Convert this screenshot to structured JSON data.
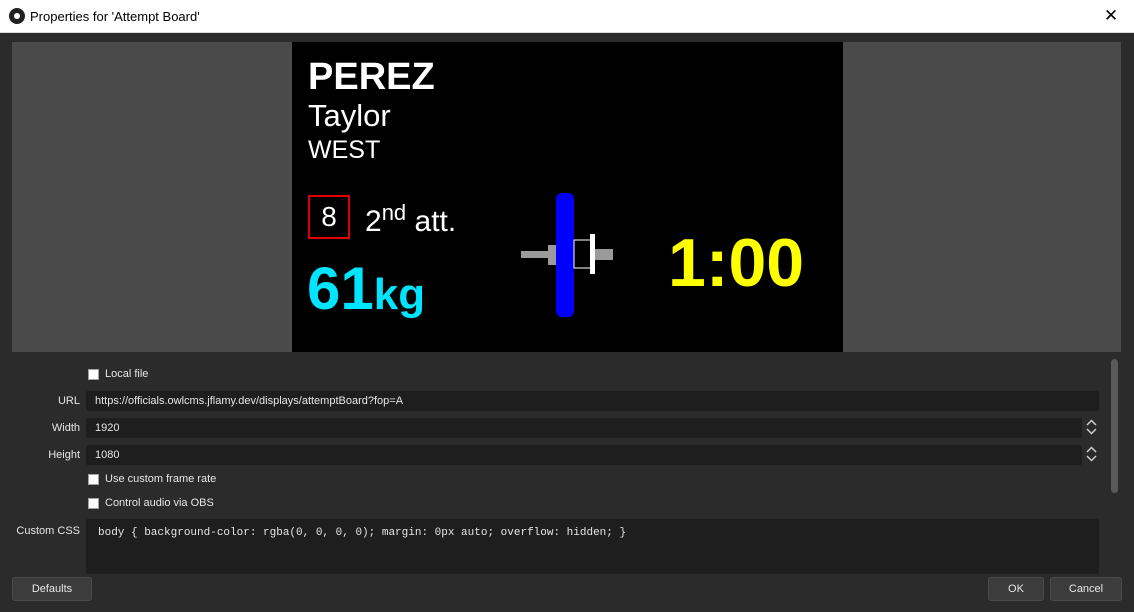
{
  "window": {
    "title": "Properties for 'Attempt Board'",
    "close_glyph": "✕"
  },
  "board": {
    "last_name": "PEREZ",
    "first_name": "Taylor",
    "team": "WEST",
    "start_number": "8",
    "attempt_number": "2",
    "attempt_suffix": "nd",
    "attempt_label": "att.",
    "weight": "61",
    "weight_unit": "kg",
    "clock": "1:00",
    "colors": {
      "weight": "#00e5ff",
      "clock": "#ffff00",
      "start_box": "#e00000",
      "plate": "#0000ff"
    }
  },
  "form": {
    "local_file_label": "Local file",
    "local_file_checked": false,
    "url_label": "URL",
    "url_value": "https://officials.owlcms.jflamy.dev/displays/attemptBoard?fop=A",
    "width_label": "Width",
    "width_value": "1920",
    "height_label": "Height",
    "height_value": "1080",
    "custom_frame_rate_label": "Use custom frame rate",
    "custom_frame_rate_checked": false,
    "control_audio_label": "Control audio via OBS",
    "control_audio_checked": false,
    "custom_css_label": "Custom CSS",
    "custom_css_value": "body { background-color: rgba(0, 0, 0, 0); margin: 0px auto; overflow: hidden; }"
  },
  "buttons": {
    "defaults": "Defaults",
    "ok": "OK",
    "cancel": "Cancel"
  }
}
